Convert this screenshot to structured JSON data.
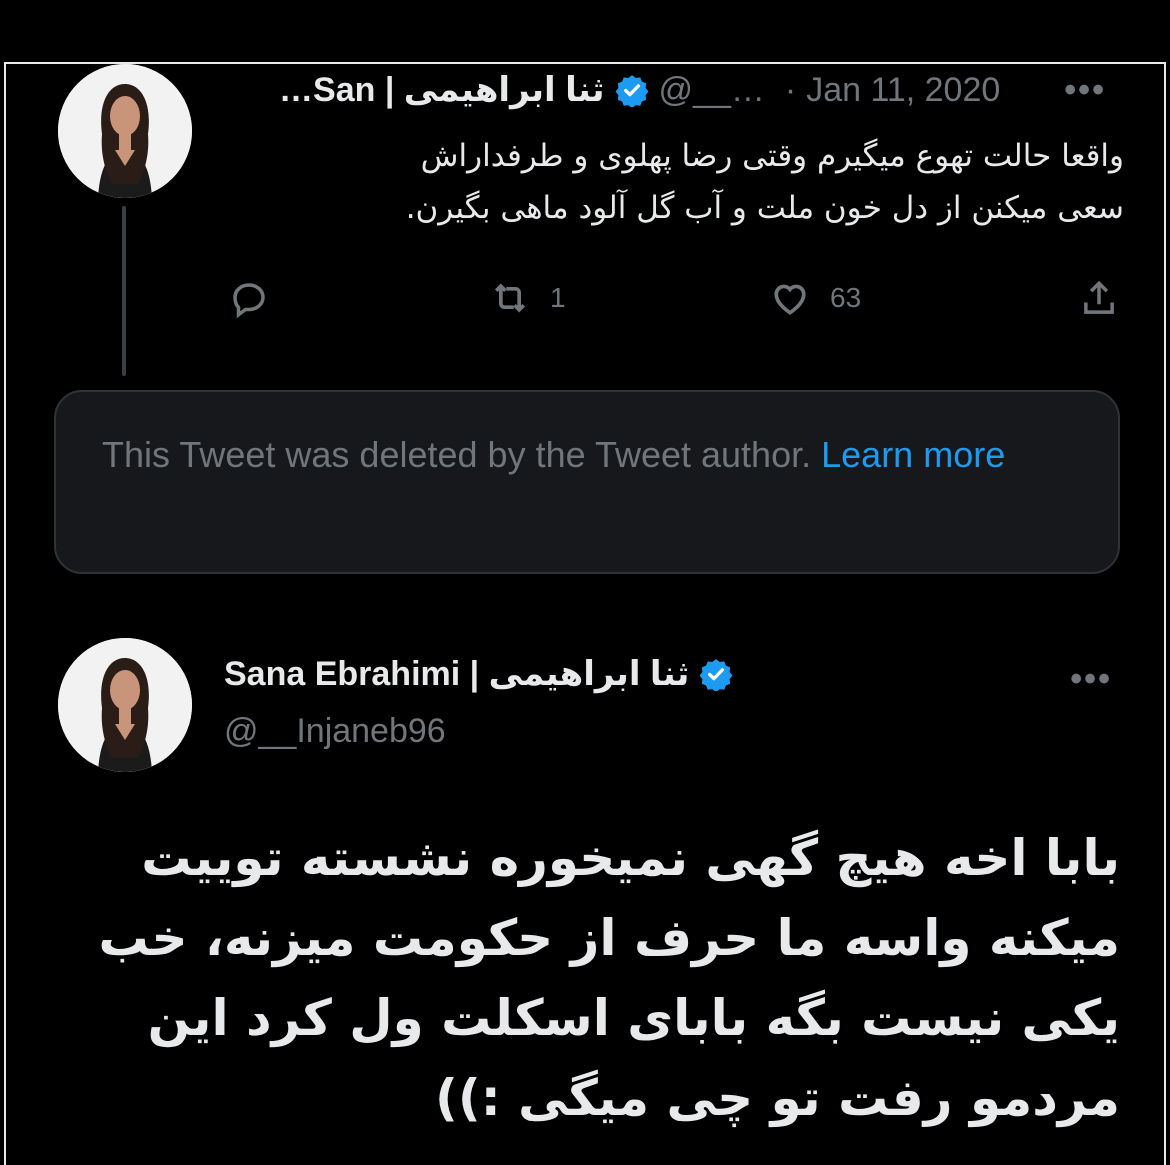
{
  "tweet1": {
    "display_name": "ثنا ابراهیمی | San…",
    "handle": "@__…",
    "separator": "·",
    "date": "Jan 11, 2020",
    "text_line1": "واقعا حالت تهوع میگیرم وقتی رضا پهلوی و طرفداراش",
    "text_line2": "سعی میکنن از دل خون ملت و آب گل آلود ماهی بگیرن.",
    "retweet_count": "1",
    "like_count": "63",
    "more_label": "•••"
  },
  "deleted_notice": {
    "text": "This Tweet was deleted by the Tweet author.",
    "link_text": "Learn more"
  },
  "tweet2": {
    "display_name": "Sana Ebrahimi | ثنا ابراهیمی",
    "handle": "@__Injaneb96",
    "more_label": "•••",
    "text_lines": [
      "بابا اخه هیچ گهی نمیخوره نشسته توییت",
      "میکنه واسه ما حرف از حکومت میزنه، خب",
      "یکی نیست بگه بابای اسکلت ول کرد این",
      "مردمو رفت تو چی میگی :))"
    ]
  },
  "icons": {
    "verified": "verified-badge-icon",
    "reply": "reply-icon",
    "retweet": "retweet-icon",
    "like": "like-icon",
    "share": "share-icon",
    "more": "more-icon"
  },
  "colors": {
    "background": "#000000",
    "text": "#e7e9ea",
    "secondary": "#71767b",
    "accent": "#1d9bf0"
  }
}
